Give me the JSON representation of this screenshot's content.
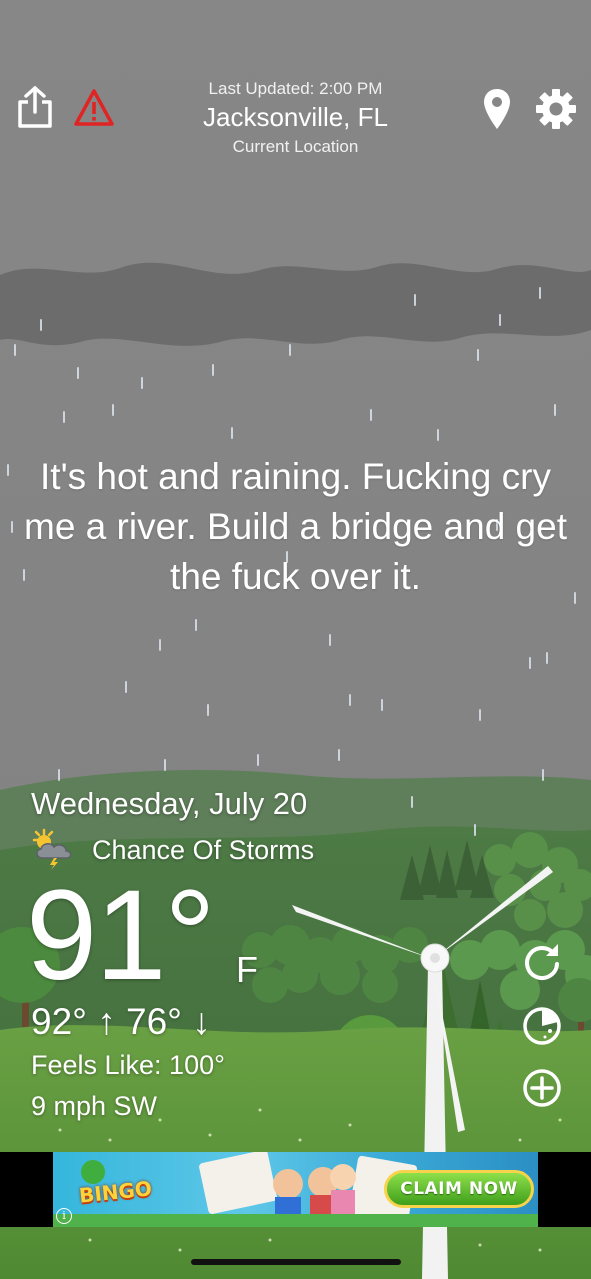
{
  "header": {
    "last_updated": "Last Updated: 2:00 PM",
    "city": "Jacksonville, FL",
    "location_label": "Current Location",
    "share_icon": "share-icon",
    "alert_icon": "warning-icon",
    "location_icon": "map-pin-icon",
    "settings_icon": "gear-icon"
  },
  "message": "It's hot and raining. Fucking cry me a river. Build a bridge and get the fuck over it.",
  "forecast": {
    "date": "Wednesday, July 20",
    "condition": "Chance Of Storms",
    "condition_icon": "storm-sun-icon",
    "temperature": "91°",
    "unit": "F",
    "high_low": "92° ↑  76° ↓",
    "feels_like": "Feels Like: 100°",
    "wind": "9 mph SW"
  },
  "side_buttons": {
    "refresh_icon": "refresh-icon",
    "radar_icon": "radar-icon",
    "add_icon": "add-icon"
  },
  "ad": {
    "brand": "BINGO",
    "cta": "CLAIM NOW",
    "info_icon": "info-icon"
  },
  "colors": {
    "sky": "#878787",
    "cloud": "#6e6e6e",
    "grass": "#5d8f3c",
    "tree_dark": "#3f6b2e",
    "ad_cta": "#5fbd2e"
  }
}
